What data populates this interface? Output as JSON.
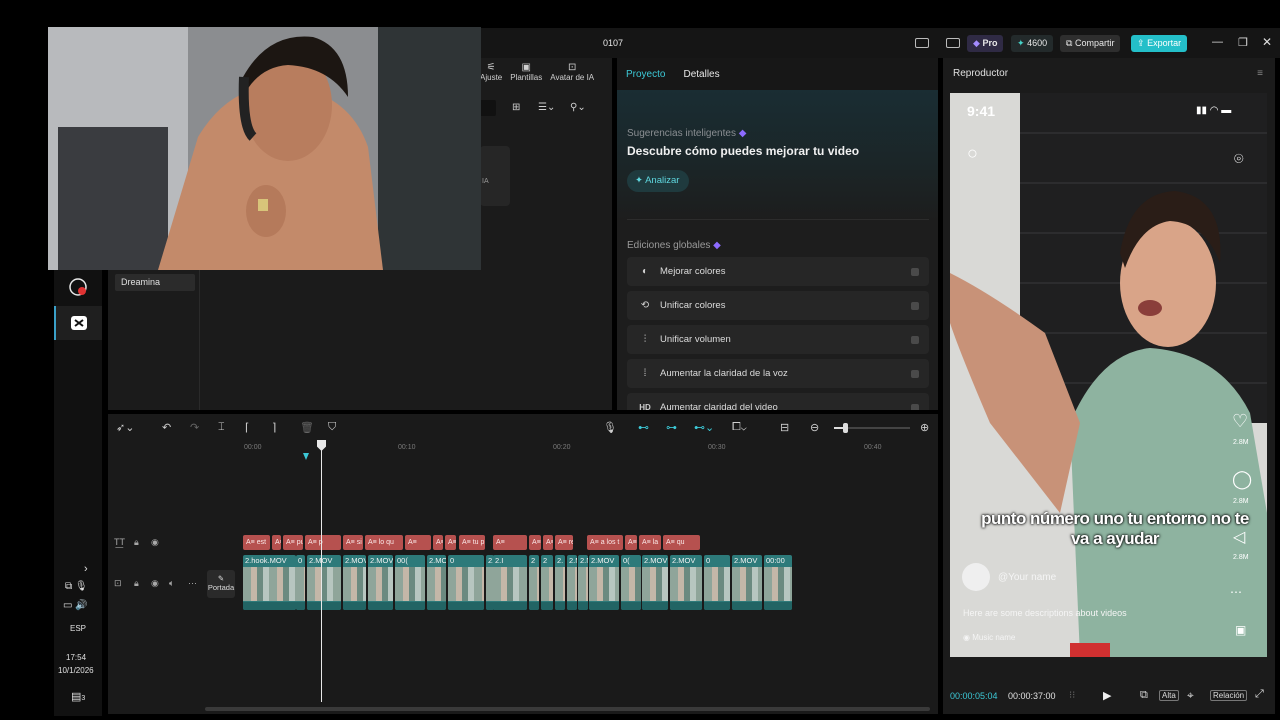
{
  "window": {
    "title": "0107",
    "pro_label": "Pro",
    "credits": "4600",
    "share_label": "Compartir",
    "export_label": "Exportar"
  },
  "media_panel": {
    "nav_tabs": [
      {
        "label": "Ajuste",
        "icon": "sliders-icon"
      },
      {
        "label": "Plantillas",
        "icon": "templates-icon"
      },
      {
        "label": "Avatar de IA",
        "icon": "avatar-icon"
      }
    ],
    "ia_badge": "IA",
    "folder_item": "Dreamina"
  },
  "properties": {
    "tabs": [
      "Proyecto",
      "Detalles"
    ],
    "active_tab": "Proyecto",
    "suggestions_label": "Sugerencias inteligentes",
    "suggestions_title": "Descubre cómo puedes mejorar tu video",
    "analyze_button": "Analizar",
    "global_edits_label": "Ediciones globales",
    "global_edits": [
      {
        "label": "Mejorar colores",
        "icon": "palette-icon"
      },
      {
        "label": "Unificar colores",
        "icon": "color-sync-icon"
      },
      {
        "label": "Unificar volumen",
        "icon": "volume-bars-icon"
      },
      {
        "label": "Aumentar la claridad de la voz",
        "icon": "voice-wave-icon"
      },
      {
        "label": "Aumentar claridad del video",
        "icon": "hd-icon",
        "icon_text": "HD"
      }
    ]
  },
  "player": {
    "title": "Reproductor",
    "current_time": "00:00:05:04",
    "total_time": "00:00:37:00",
    "quality_label": "Alta",
    "ratio_label": "Relación",
    "phone": {
      "clock": "9:41",
      "likes": [
        "2.8M",
        "2.8M",
        "2.8M"
      ],
      "caption": "punto número uno tu entorno no te va a ayudar",
      "username": "@Your name",
      "description": "Here are some descriptions about videos",
      "music": "Music name"
    }
  },
  "timeline": {
    "ruler": [
      "00:00",
      "00:10",
      "00:20",
      "00:30",
      "00:40"
    ],
    "cover_label": "Portada",
    "text_clips": [
      "est",
      "b",
      "punto",
      "p",
      "si e",
      "lo qu",
      "",
      "",
      "res",
      "tu p",
      "",
      "",
      "no s",
      "re",
      "a los t",
      "a las t",
      "la",
      "qu"
    ],
    "video_clips": [
      "2.hook.MOV",
      "0",
      "2.MOV",
      "2.MOV",
      "2.MOV",
      "00(",
      "2.MOV",
      "0",
      "2.MOV",
      "2.I",
      "2",
      "2",
      "2.",
      "2.MOV",
      "2.N",
      "2.MOV",
      "0(",
      "2.MOV",
      "2.MOV",
      "0",
      "2.MOV",
      "00:00"
    ]
  },
  "system": {
    "language": "ESP",
    "time": "17:54",
    "date": "10/1/2026",
    "notifications": "3"
  }
}
